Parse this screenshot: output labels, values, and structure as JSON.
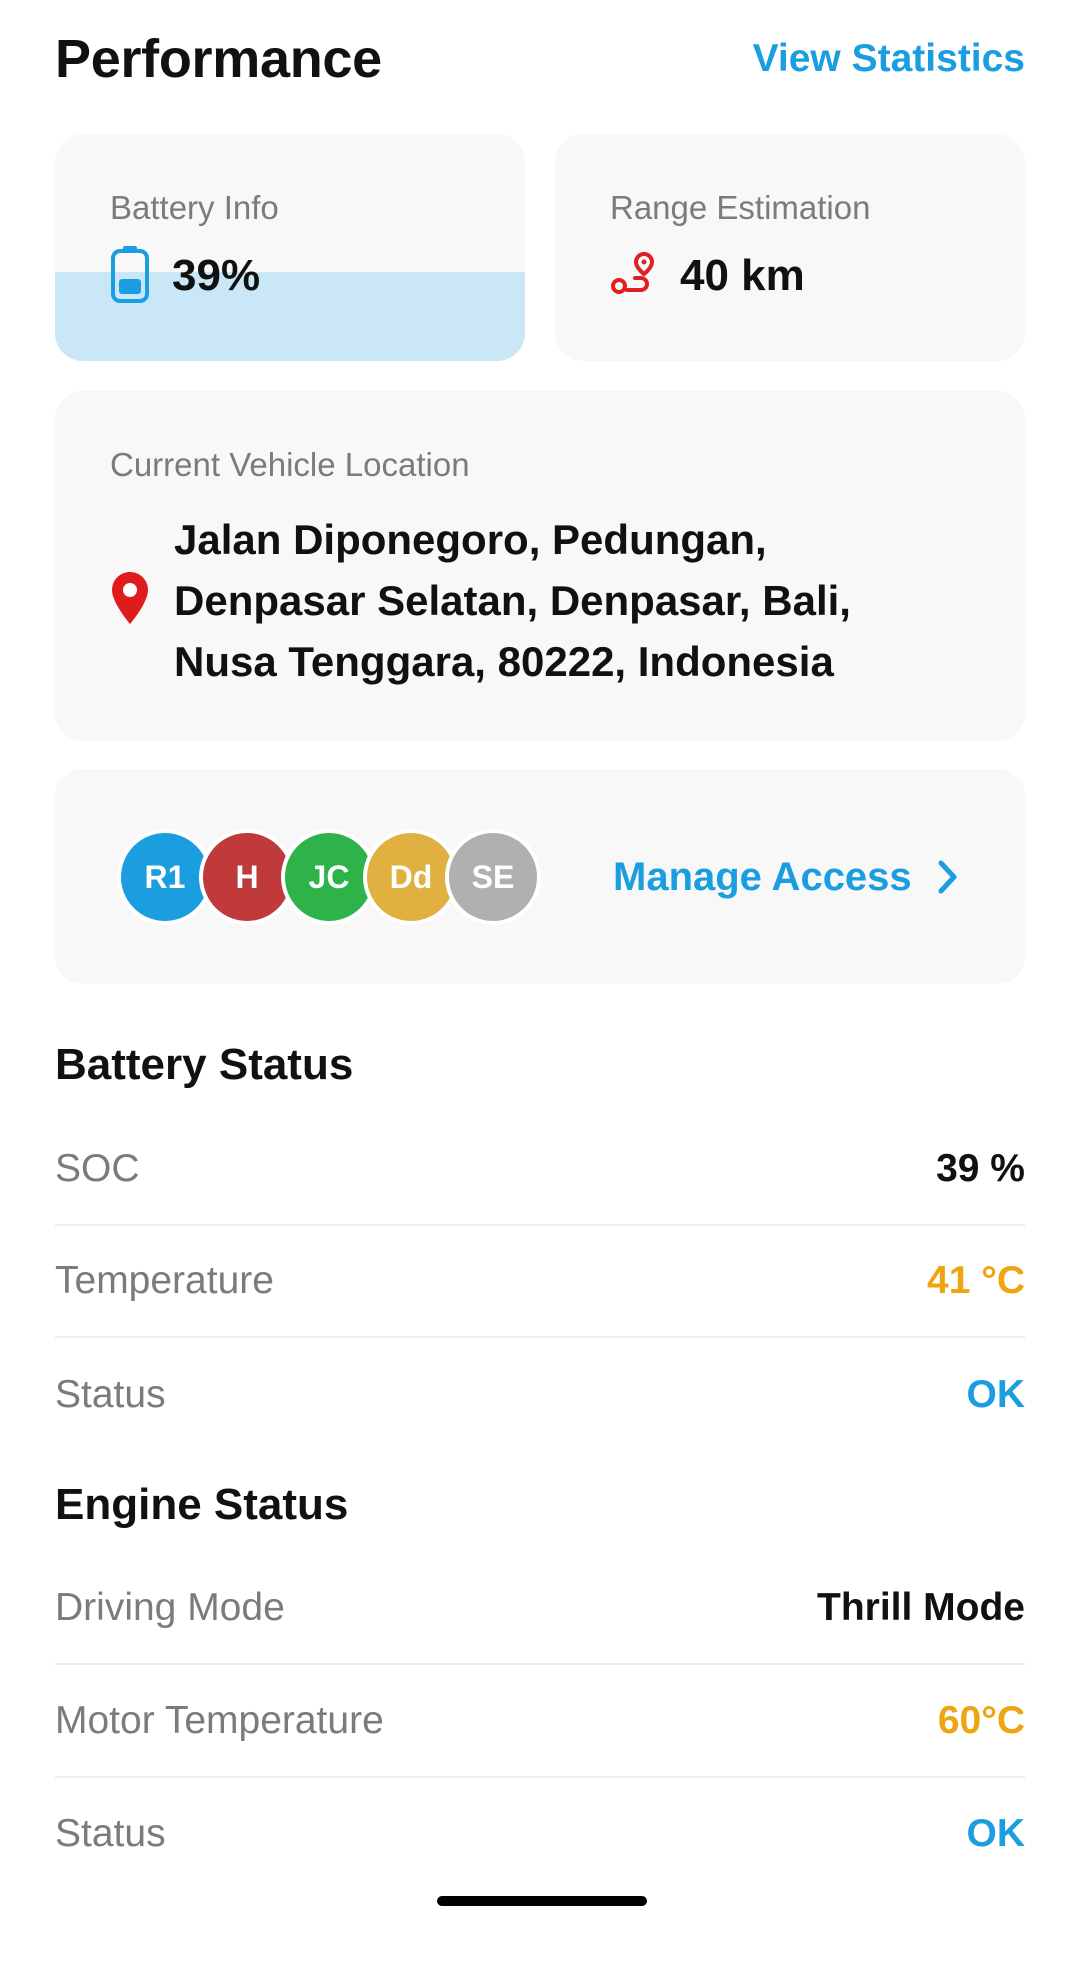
{
  "header": {
    "title": "Performance",
    "view_statistics_label": "View Statistics"
  },
  "battery_card": {
    "label": "Battery Info",
    "value": "39%",
    "fill_percent": 39,
    "icon": "battery-icon",
    "icon_color": "#1a9ee0",
    "fill_color": "#c9e7f6"
  },
  "range_card": {
    "label": "Range Estimation",
    "value": "40 km",
    "icon": "route-icon",
    "icon_color": "#e02020"
  },
  "location_card": {
    "label": "Current Vehicle Location",
    "address": "Jalan Diponegoro, Pedungan, Denpasar Selatan, Denpasar, Bali, Nusa Tenggara, 80222, Indonesia",
    "icon": "map-pin-icon",
    "icon_color": "#e01b1b"
  },
  "access_card": {
    "avatars": [
      {
        "initials": "R1",
        "color": "#1a9ee0"
      },
      {
        "initials": "H",
        "color": "#c0393b"
      },
      {
        "initials": "JC",
        "color": "#2db34a"
      },
      {
        "initials": "Dd",
        "color": "#e0b040"
      },
      {
        "initials": "SE",
        "color": "#b0b0b0"
      }
    ],
    "manage_label": "Manage Access",
    "icon": "chevron-right-icon"
  },
  "battery_status": {
    "title": "Battery Status",
    "rows": [
      {
        "label": "SOC",
        "value": "39 %",
        "color": "#111111"
      },
      {
        "label": "Temperature",
        "value": "41 °C",
        "color": "#f0a510"
      },
      {
        "label": "Status",
        "value": "OK",
        "color": "#1a9ee0"
      }
    ]
  },
  "engine_status": {
    "title": "Engine Status",
    "rows": [
      {
        "label": "Driving Mode",
        "value": "Thrill Mode",
        "color": "#111111"
      },
      {
        "label": "Motor Temperature",
        "value": "60°C",
        "color": "#f0a510"
      },
      {
        "label": "Status",
        "value": "OK",
        "color": "#1a9ee0"
      }
    ]
  },
  "accent_color": "#1a9ee0"
}
